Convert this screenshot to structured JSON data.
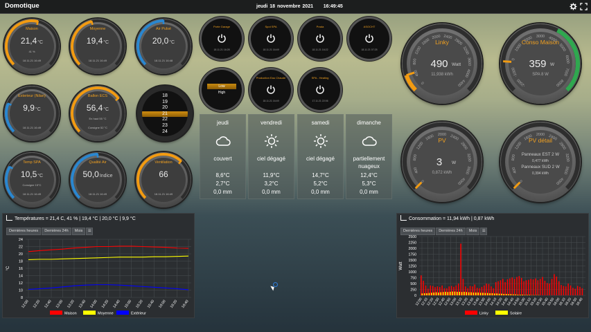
{
  "topbar": {
    "title": "Domotique",
    "date": "jeudi 18 novembre 2021",
    "time": "16:49:45",
    "icon_settings": "gear-icon",
    "icon_fullscreen": "expand-icon"
  },
  "gauges": [
    {
      "id": "maison",
      "title": "Maison",
      "value": "21,4",
      "unit": "°C",
      "line1": "41 %",
      "line2": "18.11.21 16:49",
      "color": "#f29b12",
      "fraction": 0.55
    },
    {
      "id": "moyenne",
      "title": "Moyenne",
      "value": "19,4",
      "unit": "°C",
      "line1": "",
      "line2": "18.11.21 16:49",
      "color": "#f29b12",
      "fraction": 0.45
    },
    {
      "id": "airpulse",
      "title": "Air Pulsé",
      "value": "20,0",
      "unit": "°C",
      "line1": "",
      "line2": "18.11.21 16:48",
      "color": "#2a87d0",
      "fraction": 0.5
    },
    {
      "id": "exterieur",
      "title": "Exterieur (Nilan)",
      "value": "9,9",
      "unit": "°C",
      "line1": "",
      "line2": "18.11.21 16:49",
      "color": "#2a87d0",
      "fraction": 0.25
    },
    {
      "id": "ballon",
      "title": "Ballon ECS",
      "value": "56,4",
      "unit": "°C",
      "line1": "En haut 55 °C",
      "line2": "Consigne 52 °C",
      "color": "#f29b12",
      "fraction": 0.7
    },
    {
      "id": "tempspa",
      "title": "Temp SPA",
      "value": "10,5",
      "unit": "°C",
      "line1": "Consigne 15°C",
      "line2": "18.11.21 16:49",
      "color": "#2a87d0",
      "fraction": 0.28
    },
    {
      "id": "qualite",
      "title": "Qualité Air",
      "value": "50,0",
      "unit": "Indice",
      "line1": "",
      "line2": "18.11.21 16:49",
      "color": "#2a87d0",
      "fraction": 0.5
    },
    {
      "id": "ventilation",
      "title": "Ventilation",
      "value": "66",
      "unit": "",
      "line1": "",
      "line2": "18.11.21 16:49",
      "color": "#f29b12",
      "fraction": 0.66
    }
  ],
  "thermostat": {
    "values": [
      "18",
      "19",
      "20",
      "21",
      "22",
      "23",
      "24"
    ],
    "selected": "21"
  },
  "switches": [
    {
      "title": "Porte Garage",
      "date": "18.11.21 16:28"
    },
    {
      "title": "Spot SPA",
      "date": "18.11.21 16:49"
    },
    {
      "title": "Prada",
      "date": "18.11.21 16:22"
    },
    {
      "title": "ASOCHT",
      "date": "18.11.21 07:25"
    },
    {
      "title": "Production Eau Chaude",
      "date": "18.11.21 16:49"
    },
    {
      "title": "SPA - Heating",
      "date": "17.11.21 22:06"
    }
  ],
  "mode_selector": {
    "top": "Low",
    "bottom": "High"
  },
  "weather": [
    {
      "day": "jeudi",
      "icon": "cloud-icon",
      "condition": "couvert",
      "max": "8,6°C",
      "min": "2,7°C",
      "rain": "0,0 mm"
    },
    {
      "day": "vendredi",
      "icon": "sun-icon",
      "condition": "ciel dégagé",
      "max": "11,9°C",
      "min": "3,2°C",
      "rain": "0,0 mm"
    },
    {
      "day": "samedi",
      "icon": "sun-icon",
      "condition": "ciel dégagé",
      "max": "14,7°C",
      "min": "5,2°C",
      "rain": "0,0 mm"
    },
    {
      "day": "dimanche",
      "icon": "cloud-icon",
      "condition": "partiellement nuageux",
      "max": "12,4°C",
      "min": "5,3°C",
      "rain": "0,0 mm"
    }
  ],
  "big_gauges": [
    {
      "id": "linky",
      "title": "Linky",
      "value": "490",
      "unit": "Watt",
      "sub": "11,938 kWh",
      "ticks": [
        "0",
        "400",
        "800",
        "1200",
        "1600",
        "2000",
        "2400",
        "2800",
        "3200",
        "3600",
        "4000",
        "4400"
      ],
      "arc": "#f29b12",
      "fraction": 0.1
    },
    {
      "id": "conso",
      "title": "Conso Maison",
      "value": "359",
      "unit": "W",
      "sub": "SPA 8 W",
      "ticks": [
        "-2000",
        "-1000",
        "0",
        "1000",
        "2000",
        "3000",
        "4000",
        "5000",
        "6000",
        "7000",
        "8000"
      ],
      "arc": "#2fa84f",
      "fraction": 0.18
    },
    {
      "id": "pv",
      "title": "PV",
      "value": "3",
      "unit": "W",
      "sub": "0,872 kWh",
      "ticks": [
        "0",
        "400",
        "800",
        "1200",
        "1600",
        "2000",
        "2400",
        "2800",
        "3200",
        "3600",
        "4000"
      ],
      "arc": "#f29b12",
      "fraction": 0.0
    },
    {
      "id": "pvdetail",
      "title": "PV détail",
      "value": "",
      "unit": "",
      "lines": [
        "Panneaux EST 2 W",
        "0,477 kWh",
        "Panneaux SUD 2 W",
        "0,394 kWh"
      ],
      "ticks": [
        "0",
        "400",
        "800",
        "1200",
        "1600",
        "2000",
        "2400",
        "2800",
        "3200",
        "3600",
        "4000"
      ],
      "arc": "#f29b12",
      "fraction": 0.0
    }
  ],
  "temp_panel": {
    "header": "Températures  =  21,4 C, 41 % | 19,4 °C | 20,0 °C | 9,9 °C",
    "tabs": [
      "Dernières heures",
      "Dernières 24h",
      "Mois",
      "☰"
    ]
  },
  "conso_panel": {
    "header": "Consommation  =  11,94 kWh | 0,87 kWh",
    "tabs": [
      "Dernières heures",
      "Dernières 24h",
      "Mois",
      "☰"
    ]
  },
  "chart_data": [
    {
      "type": "line",
      "ylabel": "°C",
      "ylim": [
        8,
        24
      ],
      "yticks": [
        8,
        10,
        12,
        14,
        16,
        18,
        20,
        22,
        24
      ],
      "x": [
        "12:00",
        "12:20",
        "12:40",
        "13:00",
        "13:20",
        "13:40",
        "14:00",
        "14:20",
        "14:40",
        "15:00",
        "15:20",
        "15:40",
        "16:00",
        "16:20",
        "16:40"
      ],
      "series": [
        {
          "name": "Maison",
          "color": "#ff0000",
          "values": [
            20.6,
            20.9,
            21.1,
            21.3,
            21.6,
            21.8,
            22.0,
            22.0,
            22.1,
            22.1,
            22.0,
            21.9,
            21.8,
            21.6,
            21.5
          ]
        },
        {
          "name": "Moyenne",
          "color": "#ffff00",
          "values": [
            18.4,
            18.5,
            18.5,
            18.6,
            18.7,
            18.8,
            18.9,
            19.0,
            19.1,
            19.1,
            19.1,
            19.2,
            19.2,
            19.3,
            19.4
          ]
        },
        {
          "name": "Extérieur",
          "color": "#0000ff",
          "values": [
            10.2,
            10.4,
            10.6,
            10.9,
            11.2,
            11.4,
            11.5,
            11.5,
            11.4,
            11.2,
            11.0,
            10.8,
            10.6,
            10.4,
            10.1
          ]
        }
      ],
      "legend_position": "bottom",
      "grid": true
    },
    {
      "type": "bar",
      "ylabel": "Watt",
      "ylim": [
        0,
        2500
      ],
      "yticks": [
        0,
        250,
        500,
        750,
        1000,
        1250,
        1500,
        1750,
        2000,
        2250,
        2500
      ],
      "x": [
        "12:00",
        "12:10",
        "12:20",
        "12:30",
        "12:40",
        "12:50",
        "13:00",
        "13:10",
        "13:20",
        "13:30",
        "13:40",
        "13:50",
        "14:00",
        "14:10",
        "14:20",
        "14:30",
        "14:40",
        "14:50",
        "15:00",
        "15:10",
        "15:20",
        "15:30",
        "15:40",
        "15:50",
        "16:00",
        "16:10",
        "16:20",
        "16:30",
        "16:40"
      ],
      "series": [
        {
          "name": "Linky",
          "color": "#ff0000",
          "values": [
            850,
            620,
            420,
            280,
            420,
            400,
            350,
            380,
            350,
            420,
            300,
            300,
            380,
            400,
            360,
            420,
            500,
            2200,
            700,
            380,
            300,
            400,
            380,
            460,
            320,
            300,
            360,
            420,
            500,
            480,
            380,
            300,
            560,
            600,
            640,
            700,
            560,
            680,
            720,
            760,
            700,
            780,
            820,
            740,
            600,
            640,
            660,
            700,
            680,
            720,
            640,
            700,
            780,
            620,
            520,
            500,
            700,
            900,
            800,
            600,
            440,
            400,
            380,
            500,
            420,
            320,
            280,
            400,
            360,
            300
          ]
        },
        {
          "name": "Solaire",
          "color": "#ffff00",
          "values": [
            80,
            90,
            90,
            100,
            110,
            120,
            130,
            120,
            130,
            140,
            150,
            140,
            150,
            160,
            160,
            150,
            150,
            140,
            150,
            140,
            130,
            130,
            120,
            120,
            120,
            110,
            110,
            100,
            100,
            90,
            90,
            80,
            80,
            70,
            70,
            60,
            60,
            50,
            50,
            40,
            40,
            30,
            30,
            30,
            20,
            20,
            20,
            10,
            10,
            10,
            10,
            0,
            0,
            0,
            0,
            0,
            0,
            0,
            0,
            0,
            0,
            0,
            0,
            0,
            0,
            0,
            0,
            0,
            0,
            0
          ]
        }
      ],
      "legend_position": "bottom",
      "grid": true
    }
  ]
}
